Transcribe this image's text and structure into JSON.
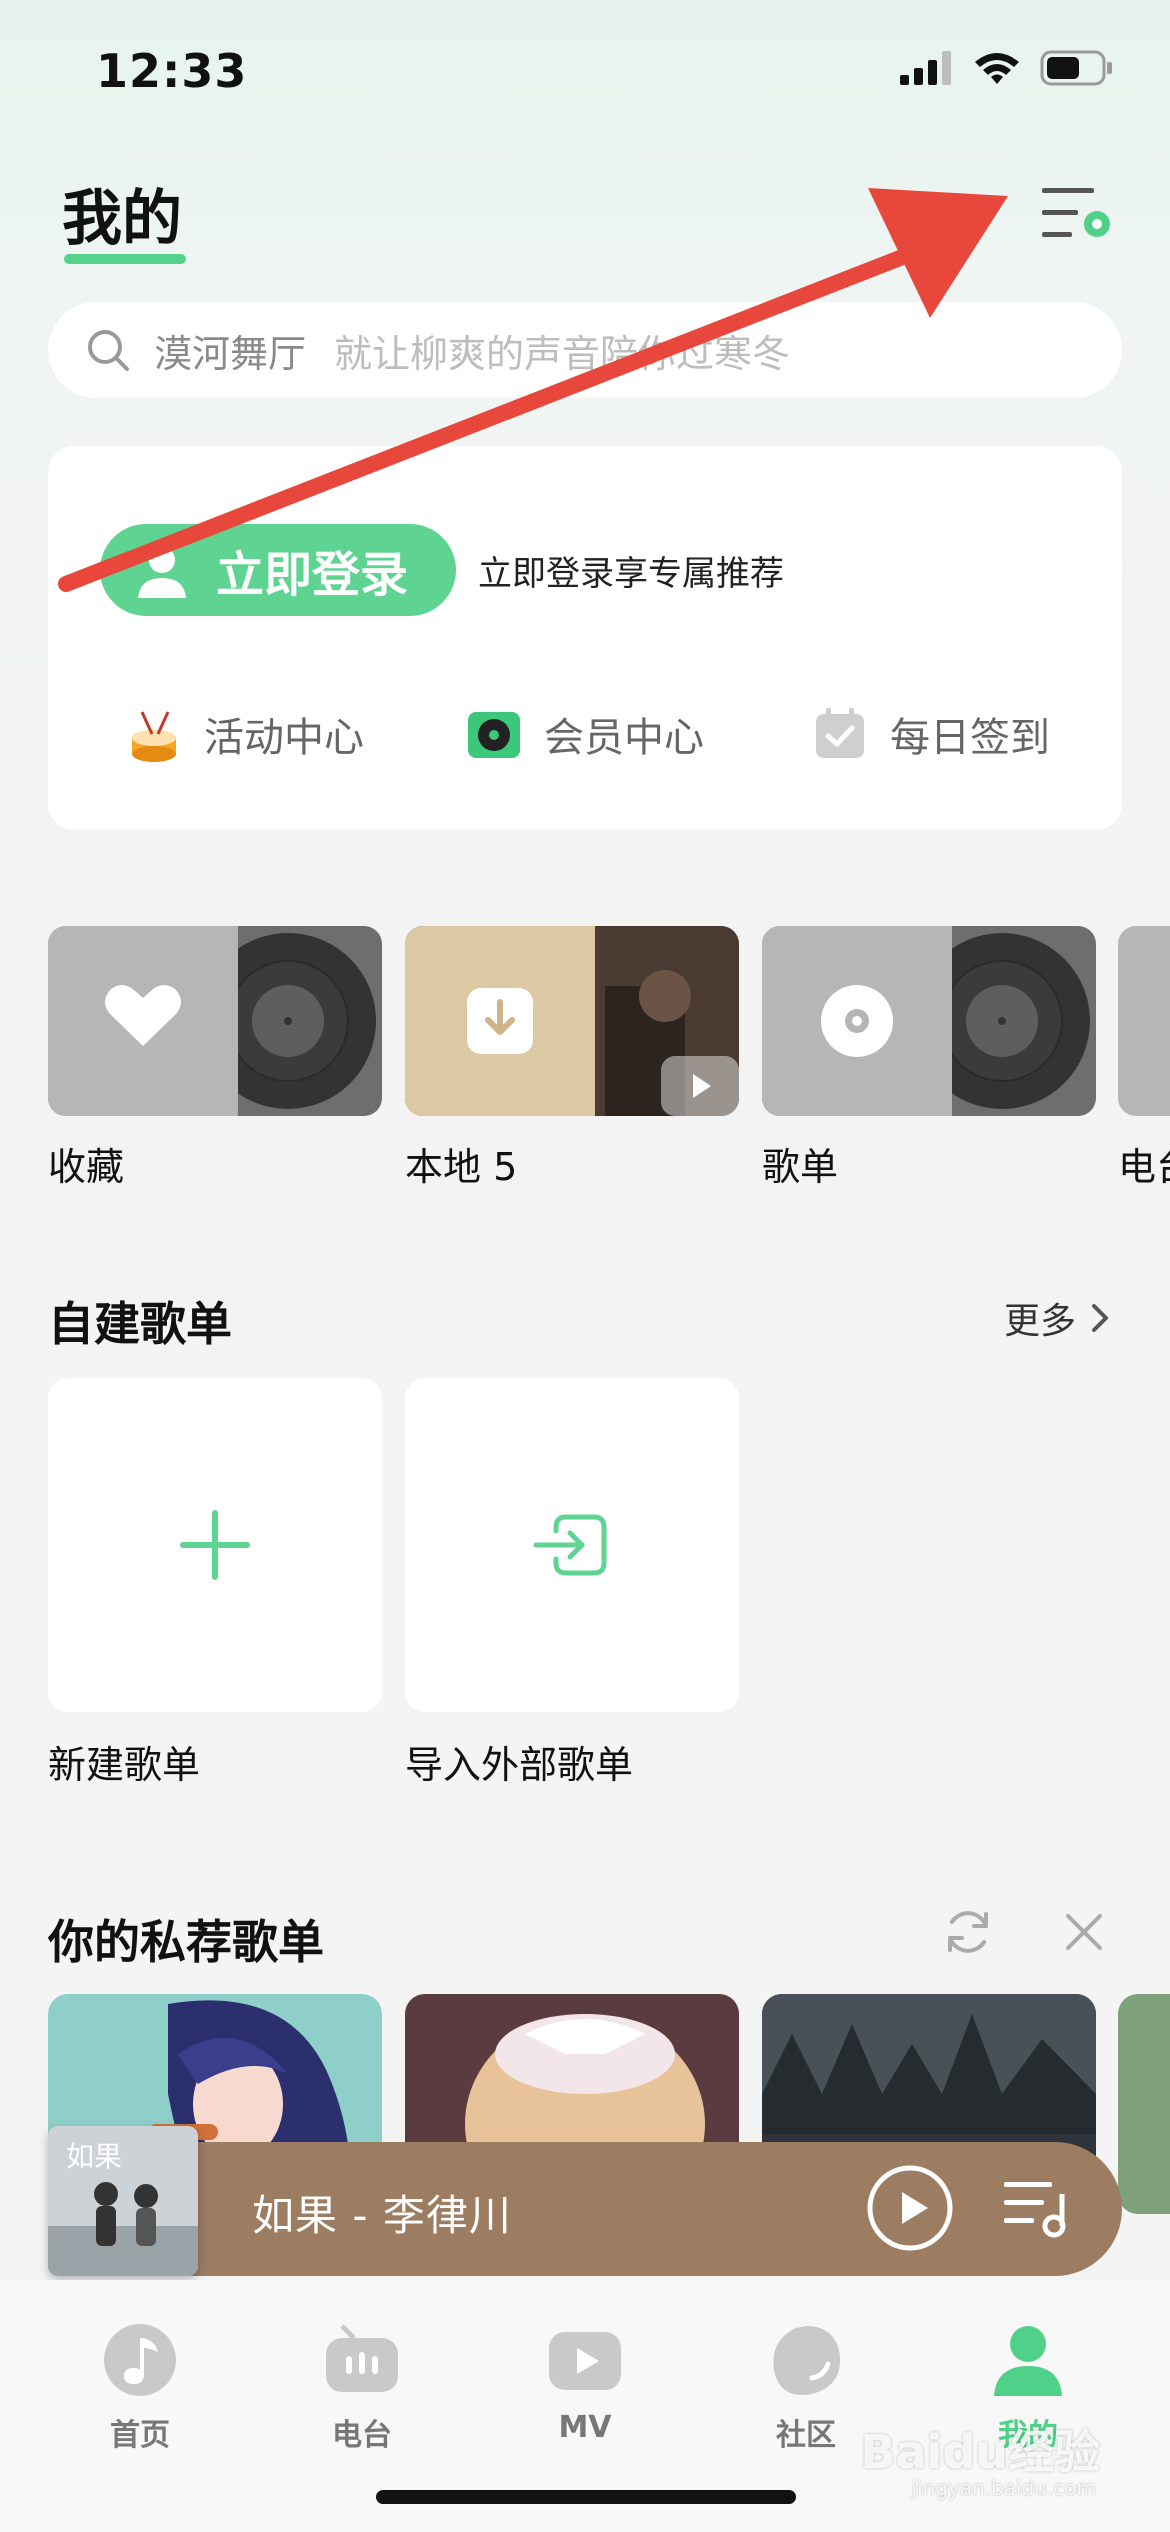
{
  "status": {
    "time": "12:33"
  },
  "header": {
    "title": "我的"
  },
  "search": {
    "keyword": "漠河舞厅",
    "hint": "就让柳爽的声音陪你过寒冬"
  },
  "login": {
    "button_label": "立即登录",
    "hint": "立即登录享专属推荐",
    "entries": [
      {
        "label": "活动中心",
        "icon": "drum-icon"
      },
      {
        "label": "会员中心",
        "icon": "turntable-icon"
      },
      {
        "label": "每日签到",
        "icon": "calendar-check-icon"
      }
    ]
  },
  "library": {
    "items": [
      {
        "label": "收藏",
        "icon": "heart-icon"
      },
      {
        "label": "本地 5",
        "icon": "download-icon"
      },
      {
        "label": "歌单",
        "icon": "disc-icon"
      },
      {
        "label": "电台"
      }
    ]
  },
  "self_playlists": {
    "title": "自建歌单",
    "more": "更多",
    "cards": [
      {
        "label": "新建歌单",
        "icon": "plus-icon"
      },
      {
        "label": "导入外部歌单",
        "icon": "import-icon"
      }
    ]
  },
  "recommend": {
    "title": "你的私荐歌单"
  },
  "player": {
    "song": "如果 - 李律川",
    "cover_text": "如果"
  },
  "tabs": [
    {
      "label": "首页",
      "icon": "music-note-icon"
    },
    {
      "label": "电台",
      "icon": "radio-icon"
    },
    {
      "label": "MV",
      "icon": "play-box-icon"
    },
    {
      "label": "社区",
      "icon": "community-icon"
    },
    {
      "label": "我的",
      "icon": "user-icon",
      "active": true
    }
  ],
  "watermark": {
    "brand": "Baidu经验",
    "url": "jingyan.baidu.com"
  },
  "colors": {
    "accent": "#55d38b",
    "annotation": "#e8473c",
    "player": "#9d7d62"
  }
}
